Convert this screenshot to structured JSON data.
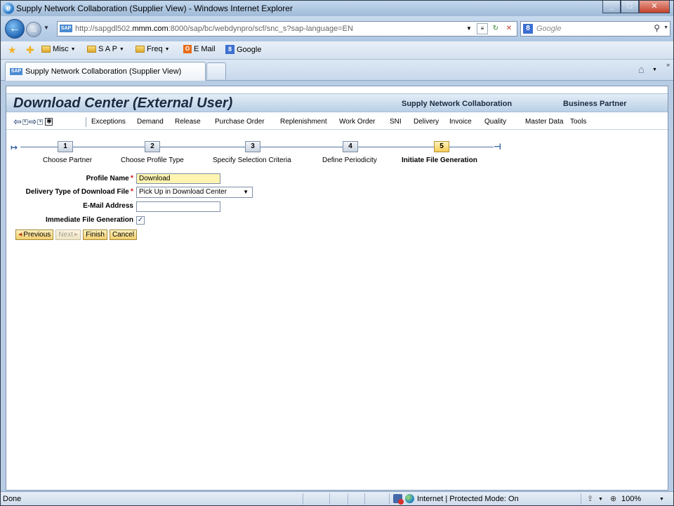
{
  "window": {
    "title": "Supply Network Collaboration (Supplier View) - Windows Internet Explorer"
  },
  "address": {
    "url_prefix": "http://sapgdl502.",
    "url_domain": "mmm.com",
    "url_suffix": ":8000/sap/bc/webdynpro/scf/snc_s?sap-language=EN",
    "search_placeholder": "Google"
  },
  "favorites": {
    "items": [
      {
        "label": "Misc",
        "icon": "folder-icon"
      },
      {
        "label": "S A P",
        "icon": "folder-icon"
      },
      {
        "label": "Freq",
        "icon": "folder-icon"
      },
      {
        "label": "E Mail",
        "icon": "outlook-icon"
      },
      {
        "label": "Google",
        "icon": "google-icon"
      }
    ]
  },
  "tab": {
    "label": "Supply Network Collaboration (Supplier View)"
  },
  "header": {
    "app_title": "Download Center (External User)",
    "link_snc": "Supply Network Collaboration",
    "link_bp": "Business Partner"
  },
  "menu": {
    "items": [
      "Exceptions",
      "Demand",
      "Release",
      "Purchase Order",
      "Replenishment",
      "Work Order",
      "SNI",
      "Delivery",
      "Invoice",
      "Quality",
      "Master Data",
      "Tools"
    ]
  },
  "roadmap": {
    "steps": [
      {
        "num": "1",
        "label": "Choose Partner"
      },
      {
        "num": "2",
        "label": "Choose Profile Type"
      },
      {
        "num": "3",
        "label": "Specify Selection Criteria"
      },
      {
        "num": "4",
        "label": "Define Periodicity"
      },
      {
        "num": "5",
        "label": "Initiate File Generation"
      }
    ],
    "active_step": 5
  },
  "form": {
    "profile_name_label": "Profile Name",
    "profile_name_value": "Download",
    "delivery_type_label": "Delivery Type of Download File",
    "delivery_type_value": "Pick Up in Download Center",
    "email_label": "E-Mail Address",
    "email_value": "",
    "immediate_label": "Immediate File Generation",
    "immediate_checked": true,
    "required_mark": "*"
  },
  "buttons": {
    "previous": "Previous",
    "next": "Next",
    "finish": "Finish",
    "cancel": "Cancel"
  },
  "status": {
    "left": "Done",
    "zone": "Internet | Protected Mode: On",
    "zoom": "100%"
  },
  "colors": {
    "accent": "#f4cc58",
    "required": "#d12a2a",
    "header_bg": "#b9d0e6"
  }
}
